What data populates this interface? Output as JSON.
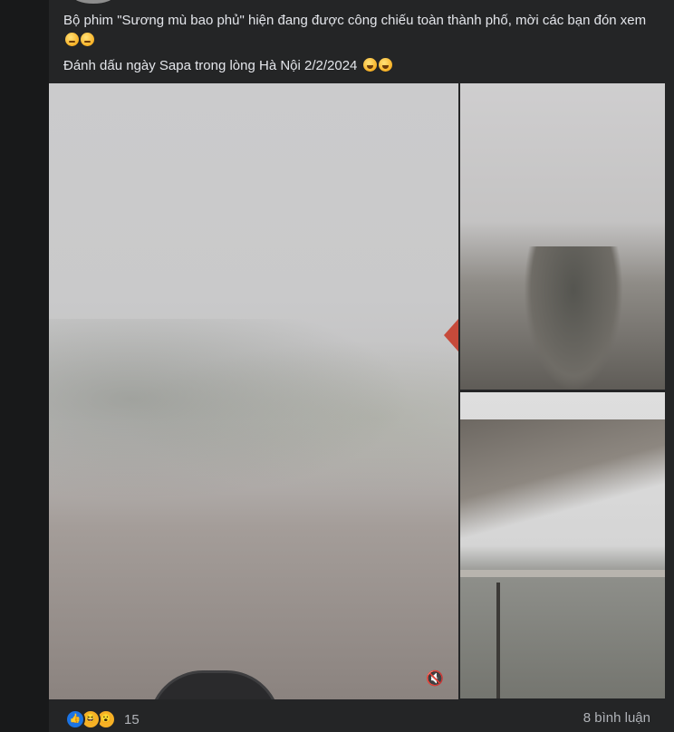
{
  "post": {
    "line1": "Bộ phim \"Sương mù bao phủ\" hiện đang được công chiếu toàn thành phố, mời các bạn đón xem",
    "line2": "Đánh dấu ngày Sapa trong lòng Hà Nội 2/2/2024",
    "line1_emojis": [
      "persevering-face",
      "persevering-face"
    ],
    "line2_emojis": [
      "grinning-squinting-face",
      "grinning-squinting-face"
    ]
  },
  "media": {
    "main_video_sound_icon": "muted-speaker-icon",
    "main_video_sound_glyph": "🔇"
  },
  "footer": {
    "reactions": [
      "like",
      "haha",
      "wow"
    ],
    "reaction_count": "15",
    "comments": "8 bình luận"
  },
  "colors": {
    "page_bg": "#18191a",
    "card_bg": "#242526",
    "text": "#e4e6eb",
    "secondary_text": "#b0b3b8",
    "like_blue": "#1b74e4"
  }
}
